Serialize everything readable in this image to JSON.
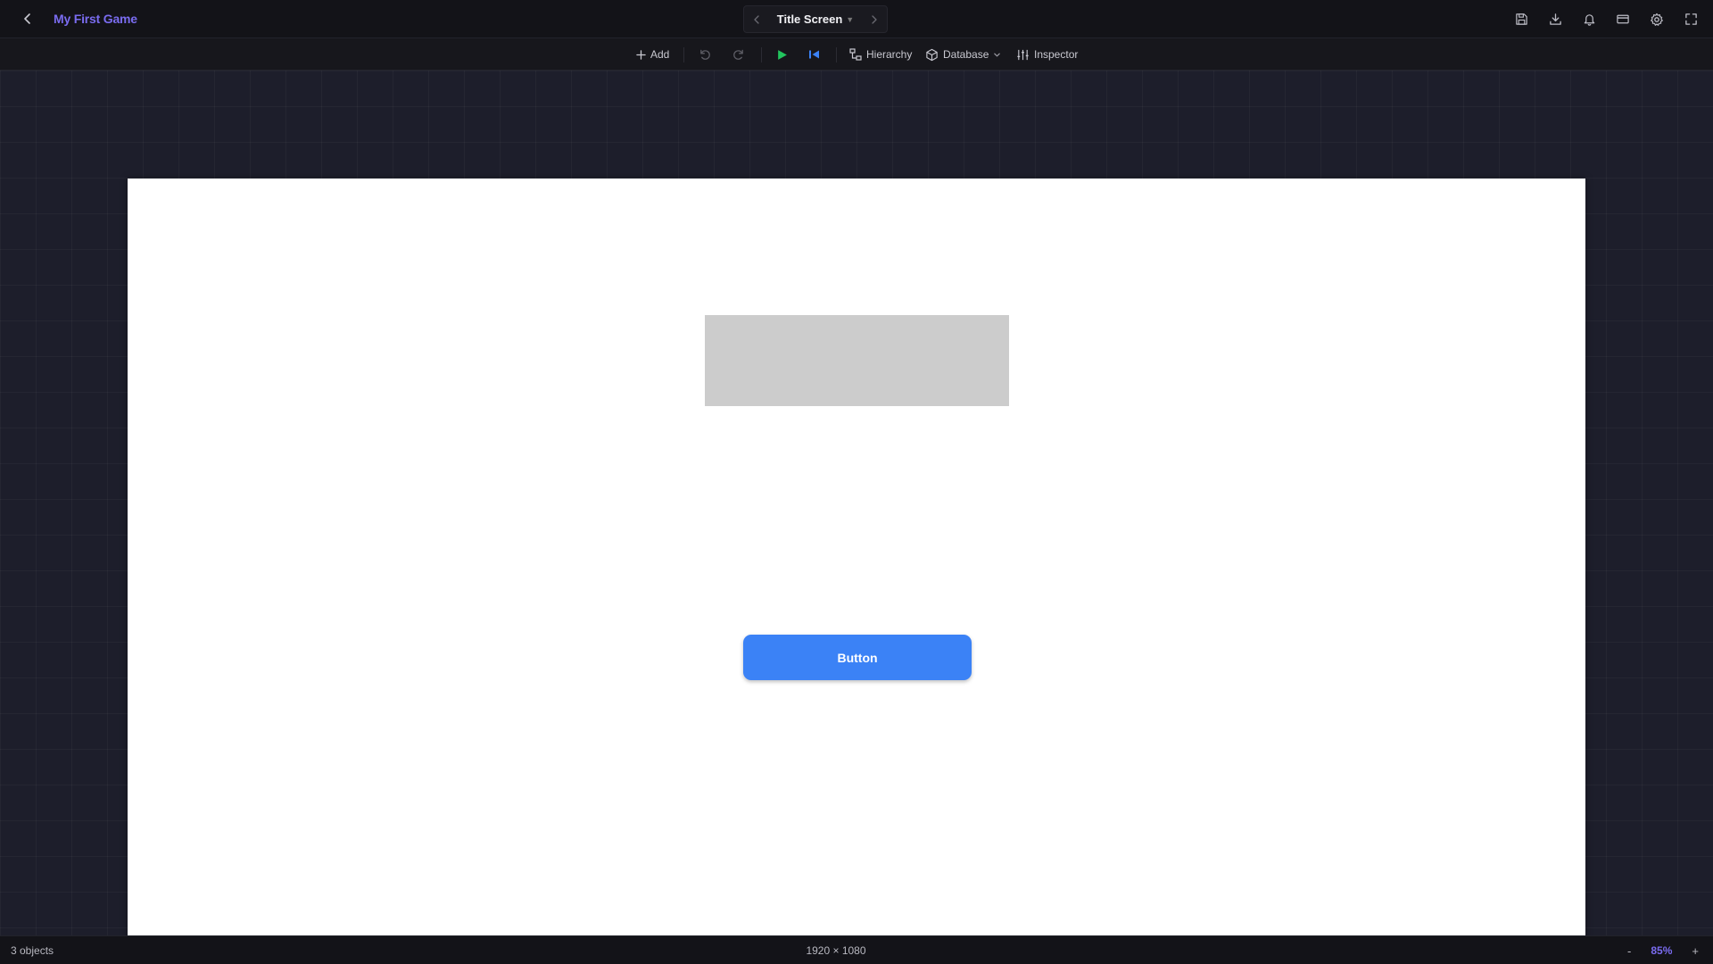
{
  "header": {
    "project_title": "My First Game",
    "scene_name": "Title Screen"
  },
  "toolbar": {
    "add_label": "Add",
    "hierarchy_label": "Hierarchy",
    "database_label": "Database",
    "inspector_label": "Inspector"
  },
  "stage": {
    "button_label": "Button"
  },
  "status": {
    "object_count": "3 objects",
    "resolution": "1920 × 1080",
    "zoom_level": "85%",
    "zoom_out": "-",
    "zoom_in": "+"
  },
  "icons": {
    "back": "chevron-left-icon",
    "save": "save-icon",
    "download": "download-icon",
    "notifications": "bell-icon",
    "billing": "credit-card-icon",
    "settings": "gear-icon",
    "fullscreen": "fullscreen-icon"
  },
  "colors": {
    "accent": "#7a6cf0",
    "play": "#22c55e",
    "restart": "#3b82f6",
    "stage_button": "#3b82f6",
    "stage_rect": "#cccccc"
  }
}
